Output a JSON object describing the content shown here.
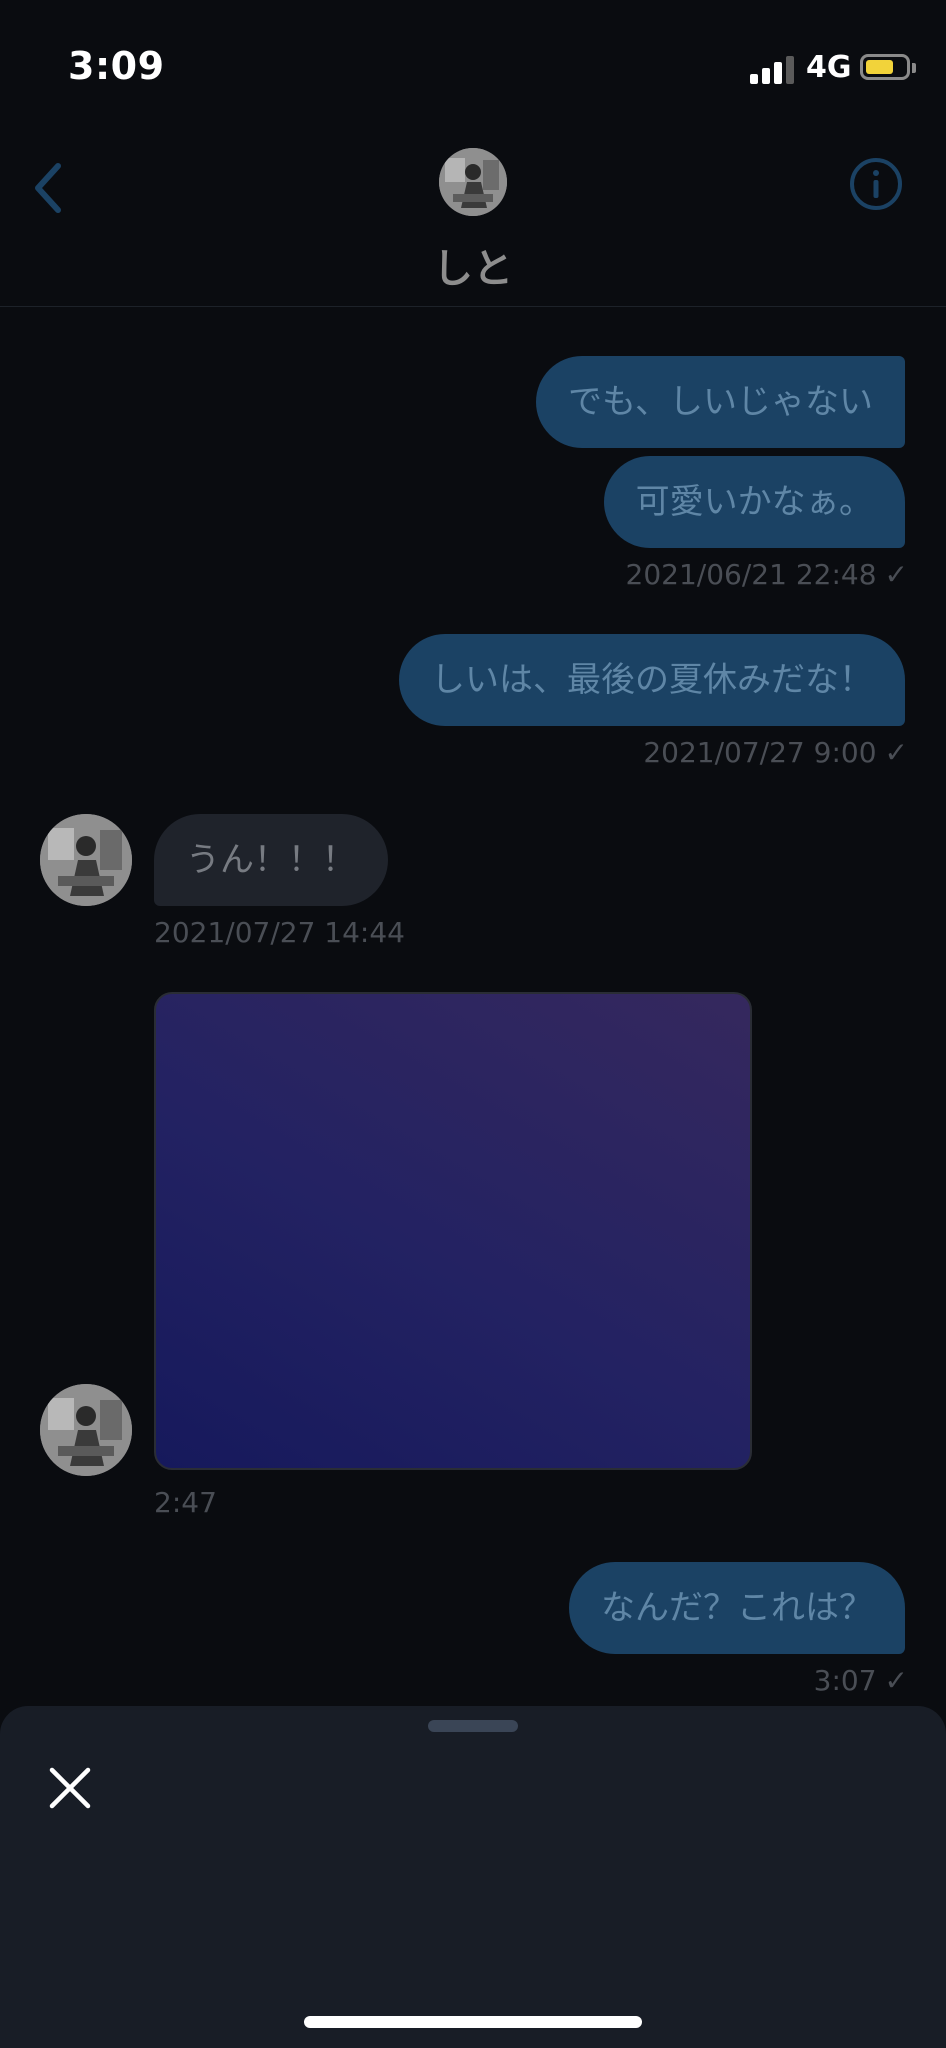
{
  "status_bar": {
    "time": "3:09",
    "network": "4G",
    "battery_color": "#f2d33a",
    "signal_bars_active": 3,
    "signal_bars_total": 4
  },
  "header": {
    "title": "しと",
    "back_icon": "chevron-left-icon",
    "info_icon": "info-circle-icon",
    "accent_color": "#1b4264"
  },
  "messages": [
    {
      "side": "out",
      "text": "でも、しいじゃない"
    },
    {
      "side": "out",
      "text": "可愛いかなぁ。",
      "timestamp": "2021/06/21 22:48"
    },
    {
      "side": "out",
      "text": "しいは、最後の夏休みだな！",
      "timestamp": "2021/07/27 9:00"
    },
    {
      "side": "in",
      "text": "うん！！！",
      "timestamp": "2021/07/27 14:44"
    },
    {
      "side": "in",
      "type": "image",
      "timestamp": "2:47"
    },
    {
      "side": "out",
      "text": "なんだ？これは？",
      "timestamp": "3:07"
    }
  ],
  "read_mark": "✓",
  "sheet": {
    "close_icon": "close-icon"
  }
}
